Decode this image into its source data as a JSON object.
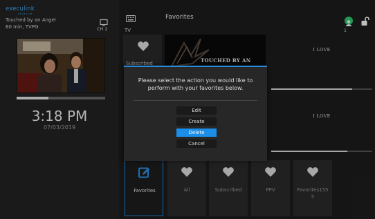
{
  "brand": {
    "logo": "execulink",
    "logo_sub": "TELECOM"
  },
  "now_playing": {
    "title": "Touched by an Angel",
    "info": "60 min, TVPG",
    "channel": "CH 2",
    "progress": 0.36
  },
  "clock": {
    "time": "3:18 PM",
    "date": "07/03/2019"
  },
  "header": {
    "section": "TV",
    "title": "Favorites",
    "profile_number": "1"
  },
  "cards": {
    "left_label": "Subscribed",
    "banner_title": "TOUCHED BY AN",
    "right_top_title": "I LOVE",
    "right_bottom_title": "I LOVE",
    "right_top_progress": 0.8,
    "right_bottom_progress": 0.75
  },
  "categories": [
    {
      "label": "Favorites",
      "icon": "edit-icon",
      "active": true
    },
    {
      "label": "All",
      "icon": "heart-icon",
      "active": false
    },
    {
      "label": "Subscribed",
      "icon": "heart-icon",
      "active": false
    },
    {
      "label": "PPV",
      "icon": "heart-icon",
      "active": false
    },
    {
      "label": "Favorites155\n5",
      "icon": "heart-icon",
      "active": false
    }
  ],
  "dialog": {
    "message": "Please select the action you would like to perform with your favorites below.",
    "options": [
      "Edit",
      "Create",
      "Delete",
      "Cancel"
    ],
    "selected": "Delete"
  },
  "colors": {
    "accent": "#1a8ee8",
    "brand": "#3fa9f5",
    "avatar": "#2ecc71"
  }
}
